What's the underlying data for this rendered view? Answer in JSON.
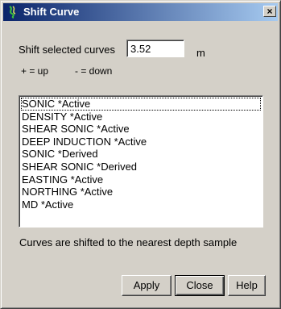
{
  "window": {
    "title": "Shift Curve",
    "close_label": "×"
  },
  "shift": {
    "label": "Shift selected curves",
    "value": "3.52",
    "unit": "m",
    "hint_up": "+ = up",
    "hint_down": "- = down"
  },
  "curves": [
    "SONIC *Active",
    "DENSITY *Active",
    "SHEAR SONIC *Active",
    "DEEP INDUCTION *Active",
    "SONIC *Derived",
    "SHEAR SONIC *Derived",
    "EASTING *Active",
    "NORTHING *Active",
    "MD *Active"
  ],
  "note": "Curves are shifted to the nearest depth sample",
  "buttons": {
    "apply": "Apply",
    "close": "Close",
    "help": "Help"
  },
  "colors": {
    "titlebar_start": "#0a246a",
    "titlebar_end": "#a6caf0",
    "face": "#d4d0c8"
  }
}
